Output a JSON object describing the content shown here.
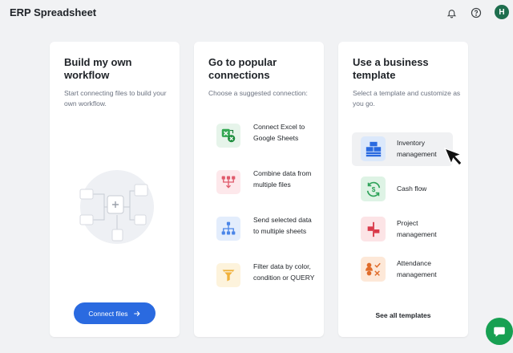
{
  "app": {
    "title": "ERP Spreadsheet"
  },
  "header": {
    "icons": [
      "bell-icon",
      "help-icon"
    ],
    "avatar_initial": "H",
    "avatar_color": "#1e6e4e"
  },
  "cards": {
    "workflow": {
      "title": "Build my own workflow",
      "subtitle": "Start connecting files to build your own workflow.",
      "button_label": "Connect files",
      "button_color": "#2a6ae0"
    },
    "connections": {
      "title": "Go to popular connections",
      "subtitle": "Choose a suggested connection:",
      "items": [
        {
          "label": "Connect Excel to Google Sheets",
          "icon": "excel-sheets-icon",
          "color": "#e6f4ea"
        },
        {
          "label": "Combine data from multiple files",
          "icon": "merge-icon",
          "color": "#fde8eb"
        },
        {
          "label": "Send selected data to multiple sheets",
          "icon": "split-icon",
          "color": "#e3edfc"
        },
        {
          "label": "Filter data by color, condition or QUERY",
          "icon": "filter-icon",
          "color": "#fdf3dc"
        }
      ]
    },
    "templates": {
      "title": "Use a business template",
      "subtitle": "Select a template and customize as you go.",
      "items": [
        {
          "label": "Inventory management",
          "icon": "inventory-icon",
          "color": "#dbe8fb",
          "active": true
        },
        {
          "label": "Cash flow",
          "icon": "cash-flow-icon",
          "color": "#def3e5",
          "active": false
        },
        {
          "label": "Project management",
          "icon": "project-icon",
          "color": "#fce4e6",
          "active": false
        },
        {
          "label": "Attendance management",
          "icon": "attendance-icon",
          "color": "#fde8d8",
          "active": false
        }
      ],
      "see_all_label": "See all templates"
    }
  },
  "chat": {
    "icon": "chat-icon",
    "color": "#17a052"
  }
}
